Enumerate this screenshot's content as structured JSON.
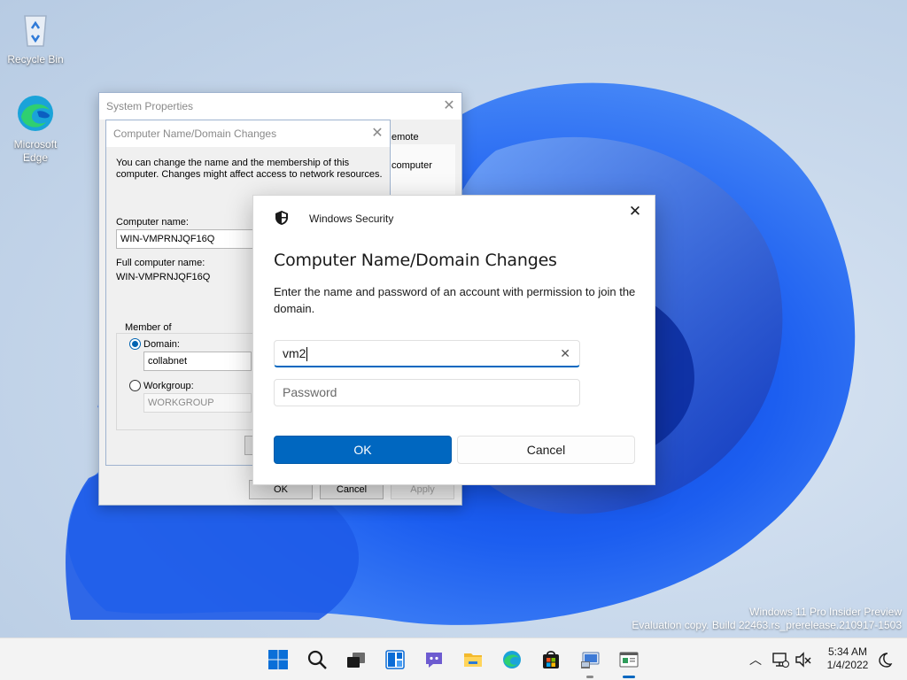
{
  "desktop": {
    "icons": [
      {
        "label": "Recycle Bin"
      },
      {
        "label": "Microsoft Edge"
      }
    ],
    "watermark": {
      "line1": "Windows 11 Pro Insider Preview",
      "line2": "Evaluation copy. Build 22463.rs_prerelease.210917-1503"
    }
  },
  "system_properties": {
    "title": "System Properties",
    "tab_partial_remote": "emote",
    "tab_partial_computer": "computer",
    "buttons": {
      "ok": "OK",
      "cancel": "Cancel",
      "apply": "Apply"
    }
  },
  "computer_name_dialog": {
    "title": "Computer Name/Domain Changes",
    "description": "You can change the name and the membership of this computer. Changes might affect access to network resources.",
    "computer_name_label": "Computer name:",
    "computer_name_value": "WIN-VMPRNJQF16Q",
    "full_name_label": "Full computer name:",
    "full_name_value": "WIN-VMPRNJQF16Q",
    "member_of_label": "Member of",
    "domain_label": "Domain:",
    "domain_value": "collabnet",
    "workgroup_label": "Workgroup:",
    "workgroup_value": "WORKGROUP",
    "selected": "domain"
  },
  "windows_security": {
    "app_title": "Windows Security",
    "heading": "Computer Name/Domain Changes",
    "body": "Enter the name and password of an account with permission to join the domain.",
    "username_value": "vm2",
    "password_placeholder": "Password",
    "ok_label": "OK",
    "cancel_label": "Cancel",
    "accent_color": "#0067c0"
  },
  "taskbar": {
    "icons": [
      "start-icon",
      "search-icon",
      "task-view-icon",
      "widgets-icon",
      "chat-icon",
      "file-explorer-icon",
      "edge-icon",
      "store-icon",
      "system-properties-icon",
      "windows-security-icon"
    ],
    "time": "5:34 AM",
    "date": "1/4/2022"
  }
}
